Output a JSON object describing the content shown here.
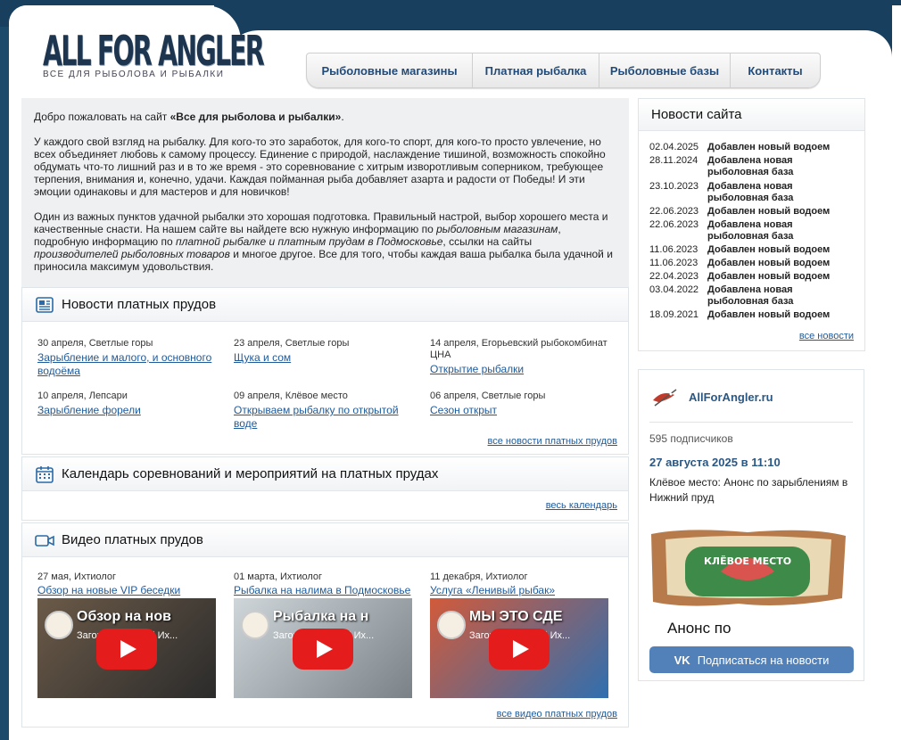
{
  "logo": {
    "title": "ALL FOR ANGLER",
    "subtitle": "ВСЕ ДЛЯ РЫБОЛОВА И РЫБАЛКИ"
  },
  "nav": [
    "Рыболовные магазины",
    "Платная рыбалка",
    "Рыболовные базы",
    "Контакты"
  ],
  "welcome": {
    "p1_pre": "Добро пожаловать на сайт ",
    "p1_bold": "«Все для рыболова и рыбалки»",
    "p1_post": ".",
    "p2": "У каждого свой взгляд на рыбалку. Для кого-то это заработок, для кого-то спорт, для кого-то просто увлечение, но всех объединяет любовь к самому процессу. Единение с природой, наслаждение тишиной, возможность спокойно обдумать что-то лишний раз и в то же время - это соревнование с хитрым изворотливым соперником, требующее терпения, внимания и, конечно, удачи. Каждая пойманная рыба добавляет азарта и радости от Победы! И эти эмоции одинаковы и для мастеров и для новичков!",
    "p3_a": "Один из важных пунктов удачной рыбалки это хорошая подготовка. Правильный настрой, выбор хорошего места и качественные снасти. На нашем сайте вы найдете всю нужную информацию по ",
    "p3_i1": "рыболовным магазинам",
    "p3_b": ", подробную информацию по ",
    "p3_i2": "платной рыбалке и платным прудам в Подмосковье",
    "p3_c": ", ссылки на сайты ",
    "p3_i3": "производителей рыболовных товаров",
    "p3_d": " и многое другое. Все для того, чтобы каждая ваша рыбалка была удачной и приносила максимум удовольствия."
  },
  "ponds_news": {
    "title": "Новости платных прудов",
    "items": [
      {
        "meta": "30 апреля, Светлые горы",
        "link": "Зарыбление и малого, и основного водоёма"
      },
      {
        "meta": "23 апреля, Светлые горы",
        "link": "Щука и сом"
      },
      {
        "meta": "14 апреля, Егорьевский рыбокомбинат ЦНА",
        "link": "Открытие рыбалки"
      },
      {
        "meta": "10 апреля, Лепсари",
        "link": "Зарыбление форели"
      },
      {
        "meta": "09 апреля, Клёвое место",
        "link": "Открываем рыбалку по открытой воде"
      },
      {
        "meta": "06 апреля, Светлые горы",
        "link": "Сезон открыт"
      }
    ],
    "more": "все новости платных прудов"
  },
  "calendar": {
    "title": "Календарь соревнований и мероприятий на платных прудах",
    "more": "весь календарь"
  },
  "videos": {
    "title": "Видео платных прудов",
    "items": [
      {
        "meta": "27 мая, Ихтиолог",
        "link": "Обзор на новые VIP беседки",
        "thumb_title": "Обзор на нов",
        "thumb_sub": "Загородный клуб Их..."
      },
      {
        "meta": "01 марта, Ихтиолог",
        "link": "Рыбалка на налима в Подмосковье",
        "thumb_title": "Рыбалка на н",
        "thumb_sub": "Загородный клуб Их..."
      },
      {
        "meta": "11 декабря, Ихтиолог",
        "link": "Услуга «Ленивый рыбак»",
        "thumb_title": "МЫ ЭТО СДЕ",
        "thumb_sub": "Загородный клуб Их..."
      }
    ],
    "more": "все видео платных прудов"
  },
  "site_news": {
    "title": "Новости сайта",
    "items": [
      {
        "date": "02.04.2025",
        "text": "Добавлен новый водоем"
      },
      {
        "date": "28.11.2024",
        "text": "Добавлена новая рыболовная база"
      },
      {
        "date": "23.10.2023",
        "text": "Добавлена новая рыболовная база"
      },
      {
        "date": "22.06.2023",
        "text": "Добавлен новый водоем"
      },
      {
        "date": "22.06.2023",
        "text": "Добавлена новая рыболовная база"
      },
      {
        "date": "11.06.2023",
        "text": "Добавлен новый водоем"
      },
      {
        "date": "11.06.2023",
        "text": "Добавлен новый водоем"
      },
      {
        "date": "22.04.2023",
        "text": "Добавлен новый водоем"
      },
      {
        "date": "03.04.2022",
        "text": "Добавлена новая рыболовная база"
      },
      {
        "date": "18.09.2021",
        "text": "Добавлен новый водоем"
      }
    ],
    "more": "все новости"
  },
  "vk": {
    "name": "AllForAngler.ru",
    "subscribers": "595 подписчиков",
    "post_date": "27 августа 2025 в 11:10",
    "post_text": "Клёвое место: Анонс по зарыблениям в Нижний пруд",
    "image_caption": "Анонс по",
    "button": "Подписаться на новости",
    "button_logo": "VK"
  },
  "colors": {
    "link": "#1f5a9a",
    "nav_text": "#1f4a7a",
    "frame": "#1b4a6b",
    "vk_button": "#5181b8"
  }
}
